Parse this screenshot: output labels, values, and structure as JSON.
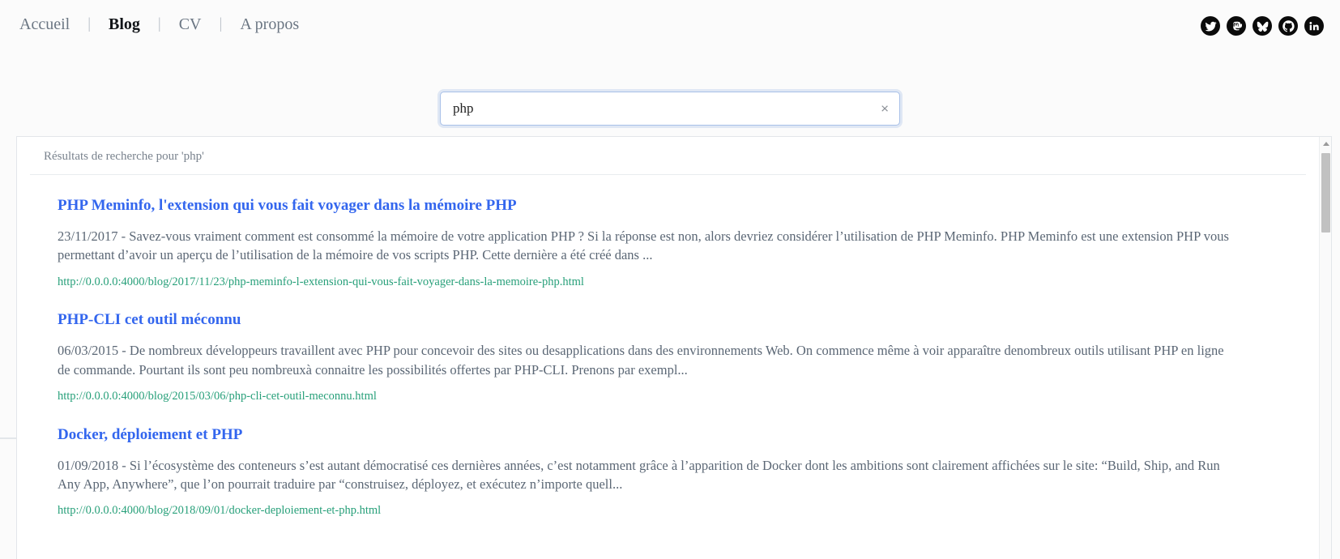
{
  "nav": {
    "items": [
      {
        "label": "Accueil",
        "active": false
      },
      {
        "label": "Blog",
        "active": true
      },
      {
        "label": "CV",
        "active": false
      },
      {
        "label": "A propos",
        "active": false
      }
    ],
    "separator": "|"
  },
  "socials": [
    {
      "name": "twitter-icon"
    },
    {
      "name": "mastodon-icon"
    },
    {
      "name": "bluesky-icon"
    },
    {
      "name": "github-icon"
    },
    {
      "name": "linkedin-icon"
    }
  ],
  "search": {
    "value": "php",
    "placeholder": "",
    "clear_label": "×"
  },
  "results": {
    "header": "Résultats de recherche pour 'php'",
    "items": [
      {
        "title": "PHP Meminfo, l'extension qui vous fait voyager dans la mémoire PHP",
        "description": "23/11/2017 - Savez-vous vraiment comment est consommé la mémoire de votre application PHP ? Si la réponse est non, alors devriez considérer l’utilisation de PHP Meminfo. PHP Meminfo est une extension PHP vous permettant d’avoir un aperçu de l’utilisation de la mémoire de vos scripts PHP. Cette dernière a été créé dans ...",
        "url": "http://0.0.0.0:4000/blog/2017/11/23/php-meminfo-l-extension-qui-vous-fait-voyager-dans-la-memoire-php.html"
      },
      {
        "title": "PHP-CLI cet outil méconnu",
        "description": "06/03/2015 - De nombreux développeurs travaillent avec PHP pour concevoir des sites ou desapplications dans des environnements Web. On commence même à voir apparaître denombreux outils utilisant PHP en ligne de commande. Pourtant ils sont peu nombreuxà connaitre les possibilités offertes par PHP-CLI. Prenons par exempl...",
        "url": "http://0.0.0.0:4000/blog/2015/03/06/php-cli-cet-outil-meconnu.html"
      },
      {
        "title": "Docker, déploiement et PHP",
        "description": "01/09/2018 - Si l’écosystème des conteneurs s’est autant démocratisé ces dernières années, c’est notamment grâce à l’apparition de Docker dont les ambitions sont clairement affichées sur le site: “Build, Ship, and Run Any App, Anywhere”, que l’on pourrait traduire par “construisez, déployez, et exécutez n’importe quell...",
        "url": "http://0.0.0.0:4000/blog/2018/09/01/docker-deploiement-et-php.html"
      }
    ]
  },
  "colors": {
    "link": "#3366ee",
    "url": "#28a07a",
    "muted": "#7a838e",
    "body": "#5b6775"
  }
}
